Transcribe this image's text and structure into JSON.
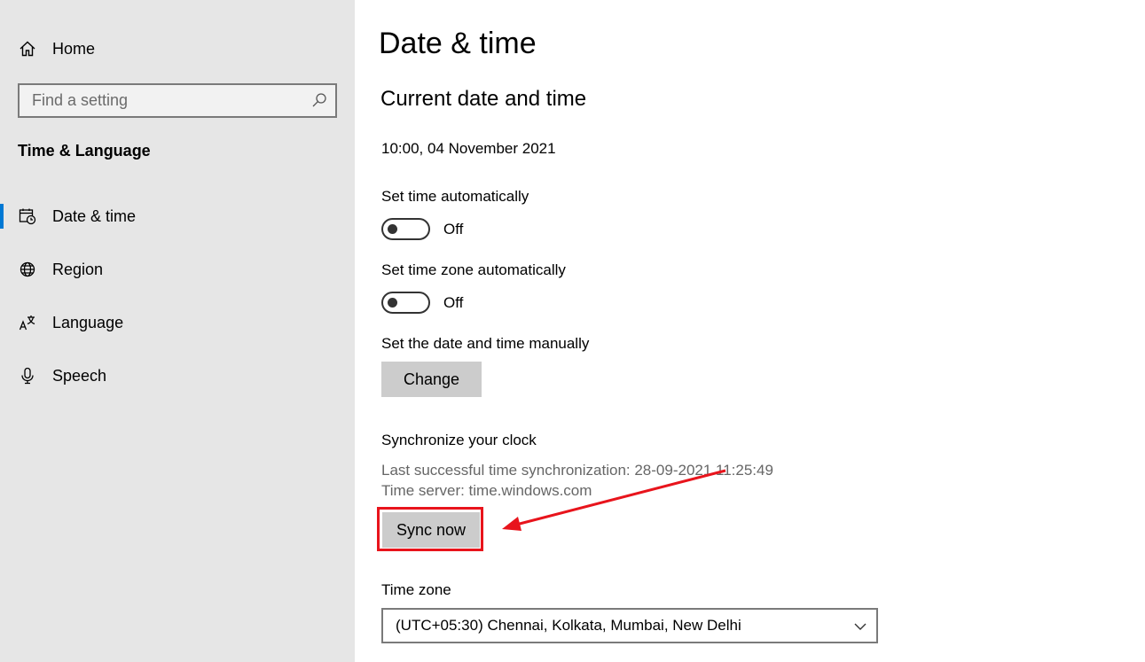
{
  "sidebar": {
    "home_label": "Home",
    "search": {
      "placeholder": "Find a setting",
      "value": ""
    },
    "section_title": "Time & Language",
    "items": [
      {
        "label": "Date & time",
        "icon": "calendar-clock-icon",
        "active": true
      },
      {
        "label": "Region",
        "icon": "globe-icon",
        "active": false
      },
      {
        "label": "Language",
        "icon": "language-icon",
        "active": false
      },
      {
        "label": "Speech",
        "icon": "microphone-icon",
        "active": false
      }
    ]
  },
  "main": {
    "title": "Date & time",
    "current_heading": "Current date and time",
    "current_datetime": "10:00, 04 November 2021",
    "set_time_auto": {
      "label": "Set time automatically",
      "state": "Off"
    },
    "set_tz_auto": {
      "label": "Set time zone automatically",
      "state": "Off"
    },
    "manual": {
      "label": "Set the date and time manually",
      "button": "Change"
    },
    "sync": {
      "heading": "Synchronize your clock",
      "last_sync": "Last successful time synchronization: 28-09-2021 11:25:49",
      "server": "Time server: time.windows.com",
      "button": "Sync now"
    },
    "timezone": {
      "label": "Time zone",
      "value": "(UTC+05:30) Chennai, Kolkata, Mumbai, New Delhi"
    }
  },
  "colors": {
    "sidebar_bg": "#e6e6e6",
    "accent": "#0078d4",
    "annotation": "#e8141c",
    "button_bg": "#cccccc"
  }
}
